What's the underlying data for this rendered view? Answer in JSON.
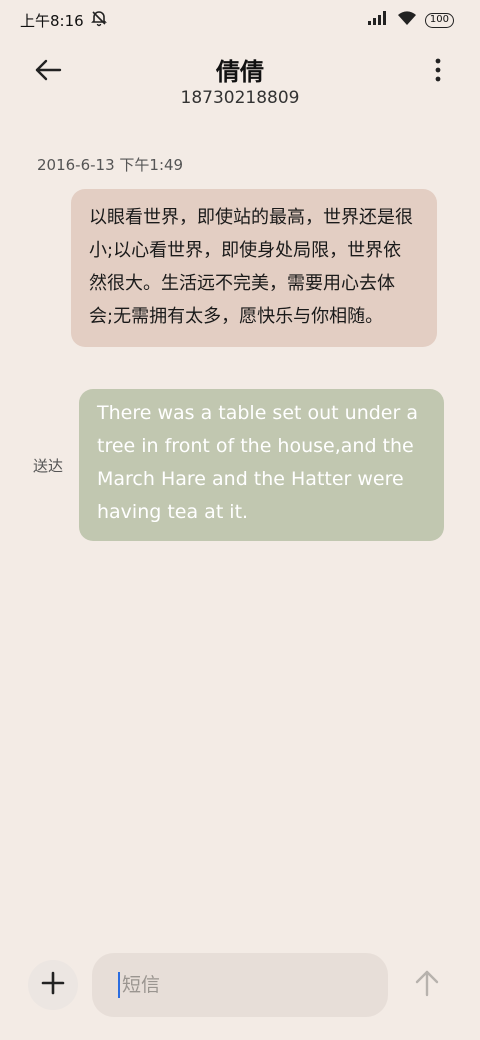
{
  "status_bar": {
    "time": "上午8:16",
    "battery": "100",
    "icons": [
      "alarm-muted-icon",
      "signal-icon",
      "wifi-icon",
      "battery-icon"
    ]
  },
  "header": {
    "back_icon": "arrow-left-icon",
    "contact_name": "倩倩",
    "contact_number": "18730218809",
    "more_icon": "more-vertical-icon"
  },
  "conversation": {
    "timestamp": "2016-6-13 下午1:49",
    "received_message": "以眼看世界，即使站的最高，世界还是很小;以心看世界，即使身处局限，世界依然很大。生活远不完美，需要用心去体会;无需拥有太多，愿快乐与你相随。",
    "sent_message": "There was a table set out under a tree in front of the house,and the March Hare and the Hatter were having tea at it.",
    "delivery_status": "送达"
  },
  "composer": {
    "add_icon": "plus-icon",
    "placeholder": "短信",
    "send_icon": "arrow-up-icon"
  },
  "colors": {
    "background": "#f3ebe5",
    "received_bubble": "#e3cec3",
    "sent_bubble": "#c1c7b0",
    "input_bg": "#e7ded8",
    "caret": "#2b6de0"
  }
}
